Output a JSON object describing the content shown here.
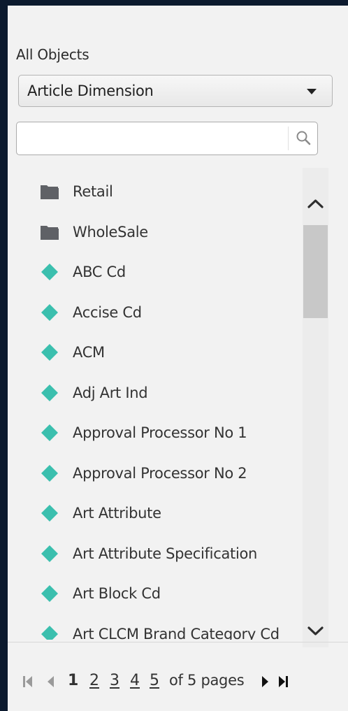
{
  "panel": {
    "section_label": "All Objects",
    "dropdown": {
      "selected": "Article Dimension"
    },
    "search": {
      "value": "",
      "placeholder": ""
    },
    "colors": {
      "folder": "#5f6166",
      "dimension": "#3bbfae",
      "background": "#f2f2f2",
      "outer": "#0c1a2e"
    },
    "items": [
      {
        "label": "Retail",
        "icon": "folder-icon",
        "type": "folder"
      },
      {
        "label": "WholeSale",
        "icon": "folder-icon",
        "type": "folder"
      },
      {
        "label": "ABC Cd",
        "icon": "dimension-icon",
        "type": "dimension"
      },
      {
        "label": "Accise Cd",
        "icon": "dimension-icon",
        "type": "dimension"
      },
      {
        "label": "ACM",
        "icon": "dimension-icon",
        "type": "dimension"
      },
      {
        "label": "Adj Art Ind",
        "icon": "dimension-icon",
        "type": "dimension"
      },
      {
        "label": "Approval Processor No 1",
        "icon": "dimension-icon",
        "type": "dimension"
      },
      {
        "label": "Approval Processor No 2",
        "icon": "dimension-icon",
        "type": "dimension"
      },
      {
        "label": "Art Attribute",
        "icon": "dimension-icon",
        "type": "dimension"
      },
      {
        "label": "Art Attribute Specification",
        "icon": "dimension-icon",
        "type": "dimension"
      },
      {
        "label": "Art Block Cd",
        "icon": "dimension-icon",
        "type": "dimension"
      },
      {
        "label": "Art CLCM Brand Category Cd",
        "icon": "dimension-icon",
        "type": "dimension"
      },
      {
        "label": "",
        "icon": "dimension-icon",
        "type": "dimension"
      }
    ]
  },
  "pager": {
    "pages": [
      "1",
      "2",
      "3",
      "4",
      "5"
    ],
    "current_page": "1",
    "of_text": "of 5 pages"
  }
}
